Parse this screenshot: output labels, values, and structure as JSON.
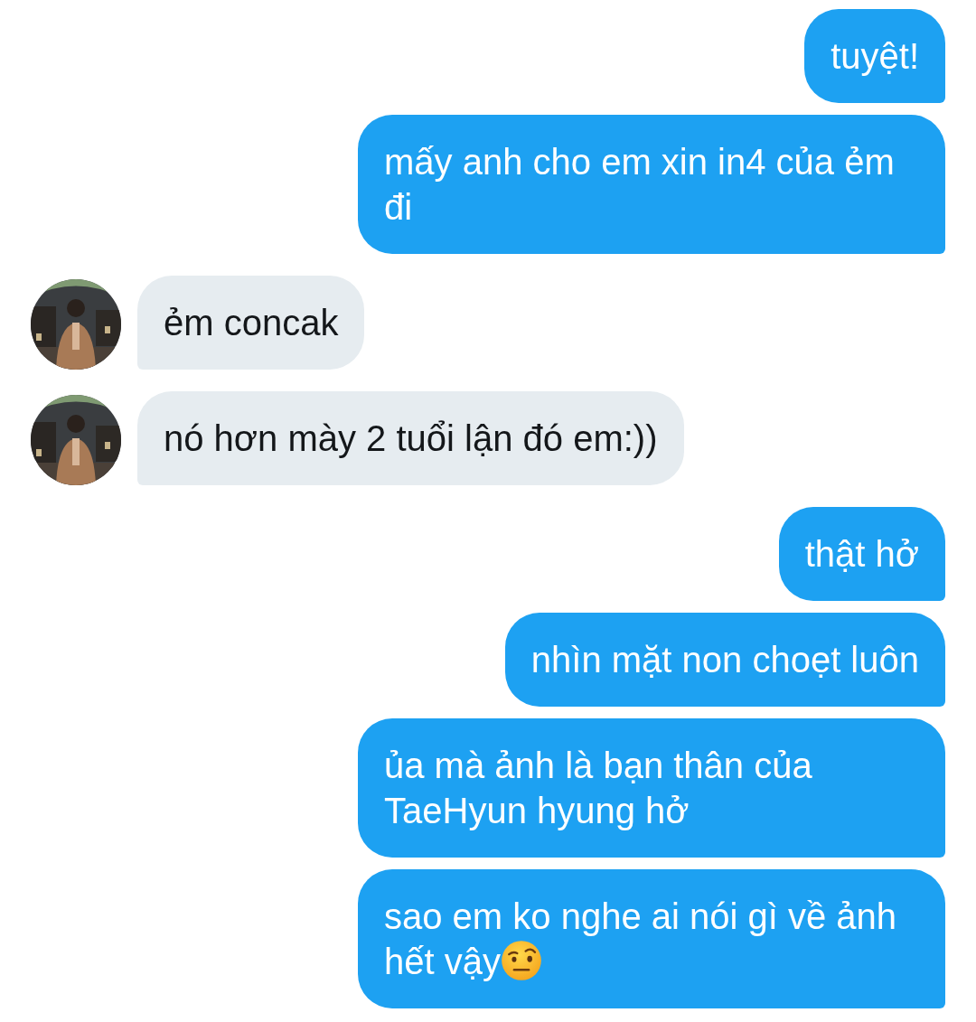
{
  "messages": [
    {
      "kind": "sent",
      "text": "tuyệt!"
    },
    {
      "kind": "sent",
      "text": "mấy anh cho em xin in4 của ẻm đi"
    },
    {
      "kind": "received",
      "text": "ẻm concak"
    },
    {
      "kind": "received",
      "text": "nó hơn mày 2 tuổi lận đó em:))"
    },
    {
      "kind": "sent",
      "text": "thật hở"
    },
    {
      "kind": "sent",
      "text": "nhìn mặt non choẹt luôn"
    },
    {
      "kind": "sent",
      "text": "ủa mà ảnh là bạn thân của TaeHyun hyung hở"
    },
    {
      "kind": "sent",
      "text": "sao em ko nghe ai nói gì về ảnh hết vậy",
      "emoji": true
    }
  ]
}
